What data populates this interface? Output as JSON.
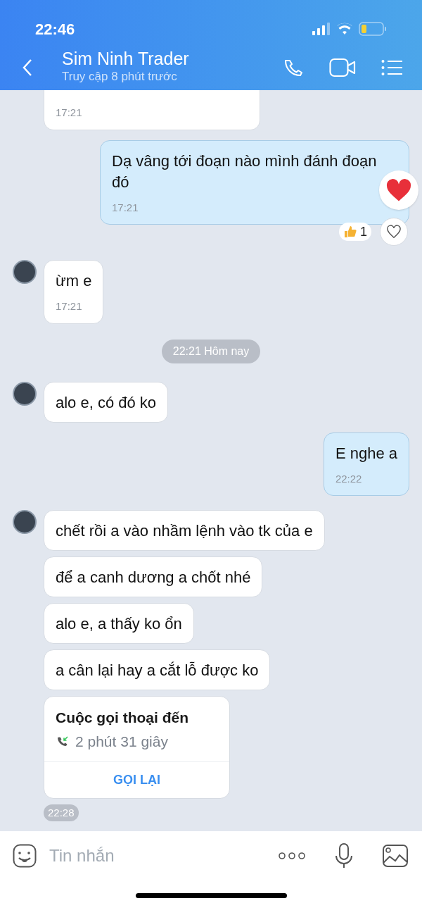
{
  "status_bar": {
    "time": "22:46"
  },
  "header": {
    "title": "Sim Ninh Trader",
    "subtitle": "Truy cập 8 phút trước"
  },
  "messages": [
    {
      "kind": "incoming",
      "avatar": false,
      "time": "17:21"
    },
    {
      "kind": "outgoing",
      "text": "Dạ vâng tới đoạn nào mình đánh đoạn đó",
      "time": "17:21",
      "heart": true,
      "reactions": [
        {
          "count": "1"
        }
      ]
    },
    {
      "kind": "incoming",
      "avatar": true,
      "text": "ừm e",
      "time": "17:21"
    },
    {
      "kind": "divider",
      "text": "22:21 Hôm nay"
    },
    {
      "kind": "incoming",
      "avatar": true,
      "text": "alo e, có đó ko"
    },
    {
      "kind": "outgoing",
      "text": "E nghe a",
      "time": "22:22"
    },
    {
      "kind": "incoming",
      "avatar": true,
      "text": "chết rồi a vào nhầm lệnh vào tk của e"
    },
    {
      "kind": "incoming",
      "avatar": false,
      "text": "để a canh dương a chốt nhé"
    },
    {
      "kind": "incoming",
      "avatar": false,
      "text": "alo e, a thấy ko ổn"
    },
    {
      "kind": "incoming",
      "avatar": false,
      "text": "a cân lại hay a cắt lỗ được ko"
    },
    {
      "kind": "call",
      "avatar": false,
      "title": "Cuộc gọi thoại đến",
      "duration": "2 phút 31 giây",
      "action": "GỌI LẠI"
    },
    {
      "kind": "time_pill",
      "text": "22:28"
    }
  ],
  "composer": {
    "placeholder": "Tin nhắn"
  }
}
